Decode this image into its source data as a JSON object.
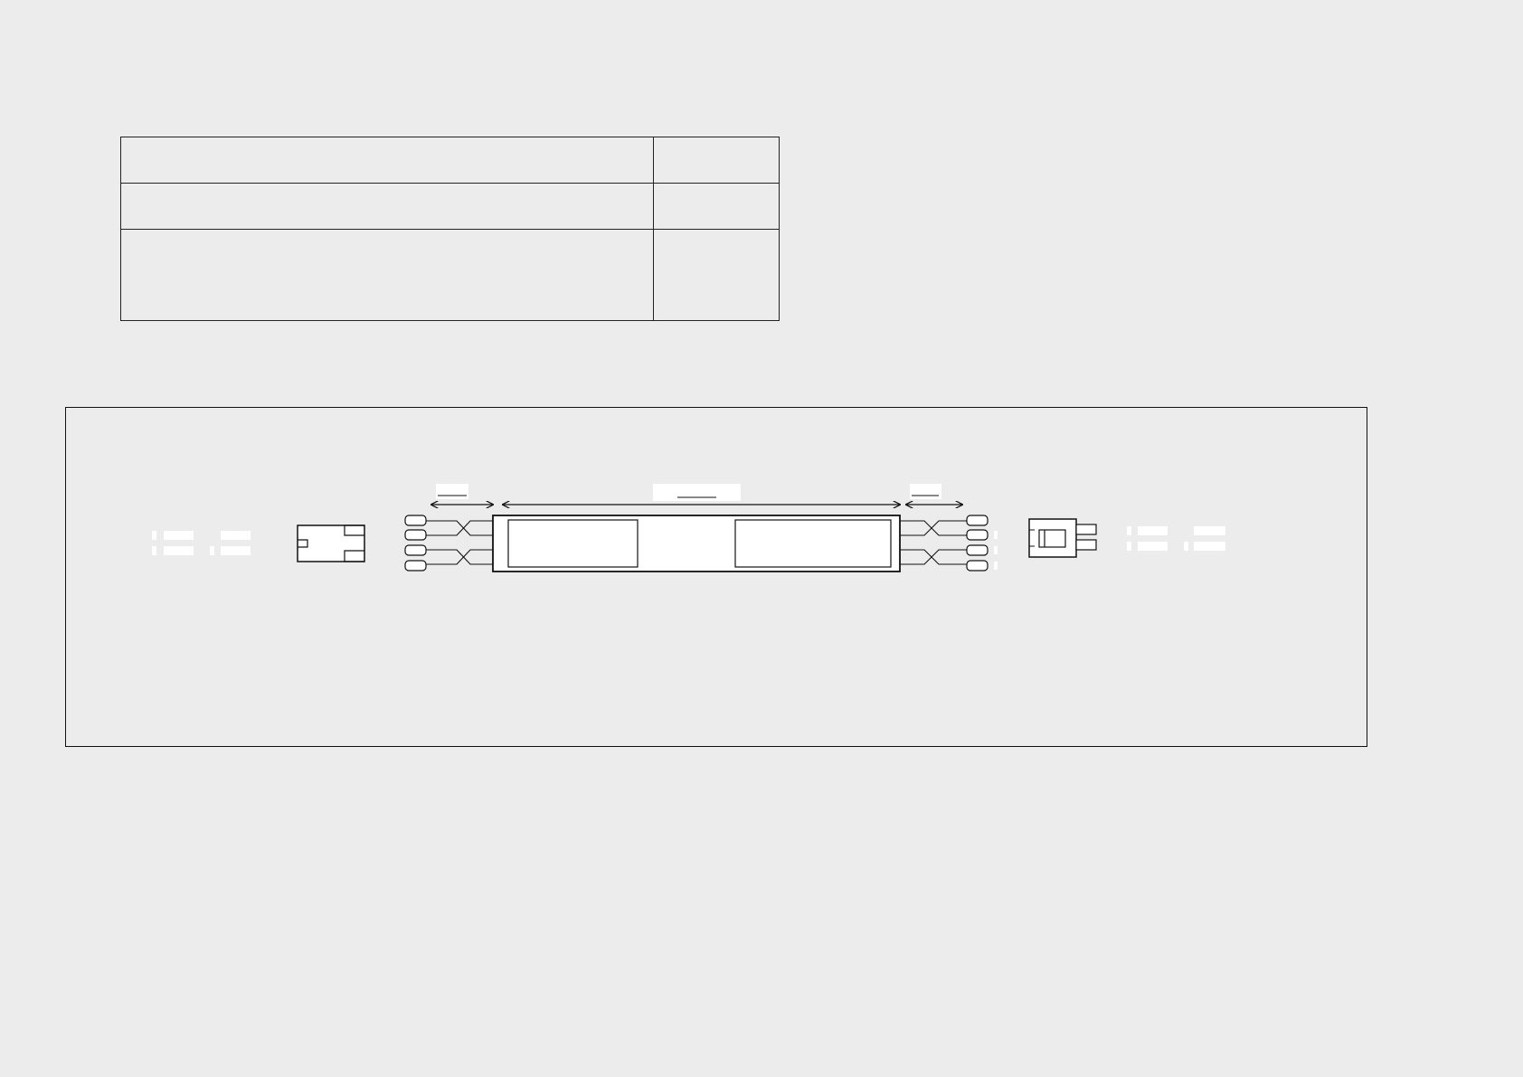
{
  "info_table": {
    "rows": [
      [
        "",
        ""
      ],
      [
        "",
        ""
      ],
      [
        "",
        ""
      ]
    ]
  },
  "diagram": {
    "dimension_labels": {
      "left_lead": "",
      "body": "",
      "right_lead": ""
    }
  },
  "colors": {
    "background": "#ececec",
    "line": "#111111",
    "fill": "#ffffff"
  },
  "icons": {
    "left_connector": "plug-housing-icon",
    "right_connector": "socket-housing-icon",
    "terminal": "crimp-terminal-icon"
  }
}
